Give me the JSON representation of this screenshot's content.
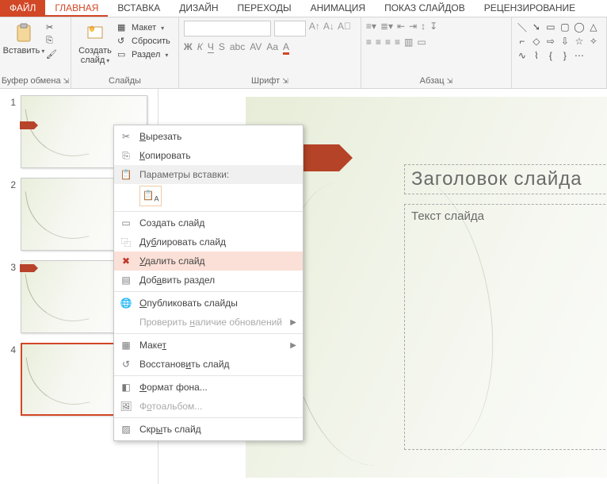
{
  "tabs": {
    "file": "ФАЙЛ",
    "home": "ГЛАВНАЯ",
    "insert": "ВСТАВКА",
    "design": "ДИЗАЙН",
    "transitions": "ПЕРЕХОДЫ",
    "animation": "АНИМАЦИЯ",
    "slideshow": "ПОКАЗ СЛАЙДОВ",
    "review": "РЕЦЕНЗИРОВАНИЕ"
  },
  "groups": {
    "clipboard": {
      "label": "Буфер обмена",
      "paste": "Вставить"
    },
    "slides": {
      "label": "Слайды",
      "new_slide": "Создать слайд",
      "layout": "Макет",
      "reset": "Сбросить",
      "section": "Раздел"
    },
    "font": {
      "label": "Шрифт"
    },
    "paragraph": {
      "label": "Абзац"
    }
  },
  "thumbs": [
    "1",
    "2",
    "3",
    "4"
  ],
  "slide": {
    "title_placeholder": "Заголовок слайда",
    "body_placeholder": "Текст слайда"
  },
  "ctx": {
    "cut": "Вырезать",
    "copy": "Копировать",
    "paste_header": "Параметры вставки:",
    "new_slide": "Создать слайд",
    "duplicate": "Дублировать слайд",
    "delete": "Удалить слайд",
    "add_section": "Добавить раздел",
    "publish": "Опубликовать слайды",
    "check_updates": "Проверить наличие обновлений",
    "layout": "Макет",
    "restore": "Восстановить слайд",
    "bg_format": "Формат фона...",
    "photo_album": "Фотоальбом...",
    "hide": "Скрыть слайд"
  }
}
